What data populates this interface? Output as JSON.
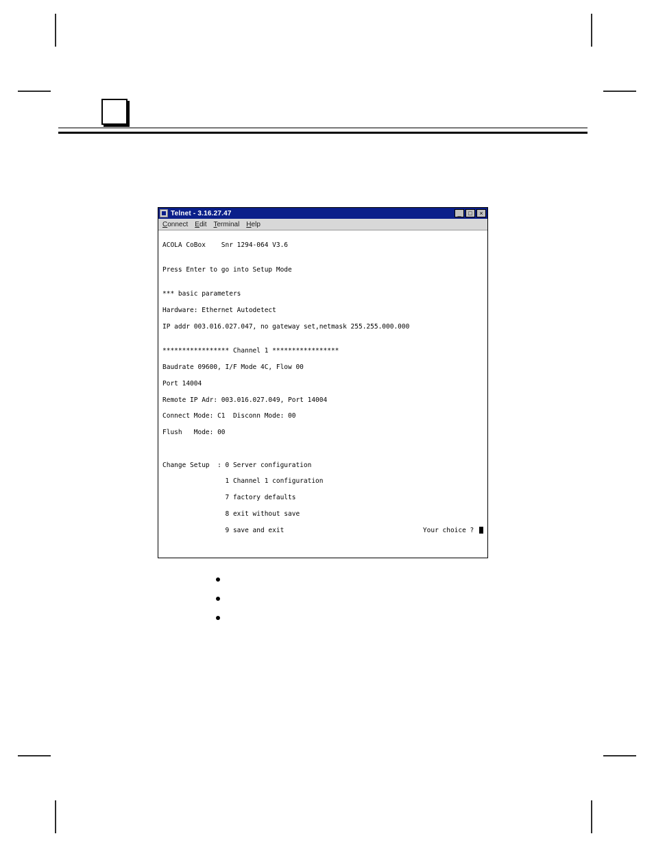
{
  "chapter_marker": "",
  "telnet": {
    "title": "Telnet - 3.16.27.47",
    "menu": {
      "connect": "Connect",
      "edit": "Edit",
      "terminal": "Terminal",
      "help": "Help"
    },
    "window_controls": {
      "min": "_",
      "max": "□",
      "close": "×"
    },
    "lines": {
      "l01": "ACOLA CoBox    Snr 1294-064 V3.6",
      "l02": "",
      "l03": "Press Enter to go into Setup Mode",
      "l04": "",
      "l05": "*** basic parameters",
      "l06": "Hardware: Ethernet Autodetect",
      "l07": "IP addr 003.016.027.047, no gateway set,netmask 255.255.000.000",
      "l08": "",
      "l09": "***************** Channel 1 *****************",
      "l10": "Baudrate 09600, I/F Mode 4C, Flow 00",
      "l11": "Port 14004",
      "l12": "Remote IP Adr: 003.016.027.049, Port 14004",
      "l13": "Connect Mode: C1  Disconn Mode: 00",
      "l14": "Flush   Mode: 00",
      "l15": "",
      "l16": "",
      "l17": "Change Setup  : 0 Server configuration",
      "l18": "                1 Channel 1 configuration",
      "l19": "                7 factory defaults",
      "l20": "                8 exit without save",
      "l21_left": "                9 save and exit",
      "l21_right": "Your choice ? "
    }
  },
  "bullets": {
    "b1": "",
    "b2": "",
    "b3": ""
  }
}
